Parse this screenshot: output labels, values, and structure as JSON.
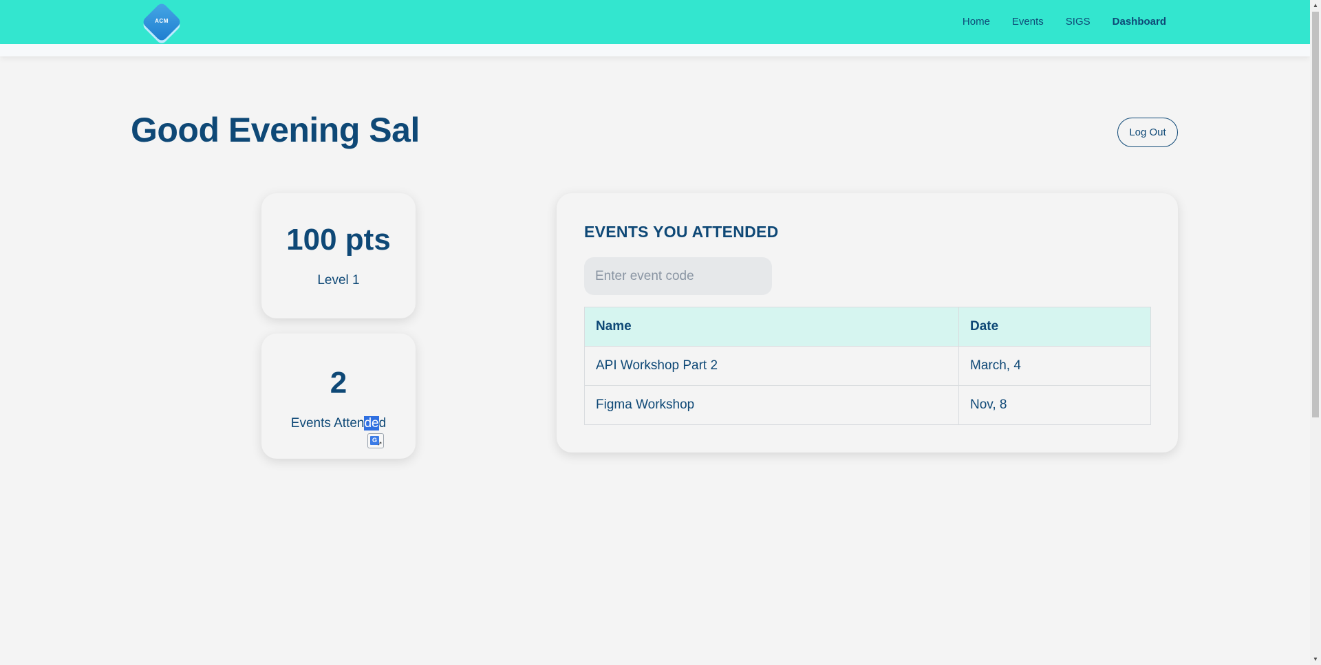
{
  "header": {
    "logo_text": "ACM",
    "nav": [
      {
        "label": "Home"
      },
      {
        "label": "Events"
      },
      {
        "label": "SIGS"
      },
      {
        "label": "Dashboard"
      }
    ]
  },
  "main": {
    "greeting": "Good Evening Sal",
    "logout_label": "Log Out"
  },
  "stats": {
    "points": "100 pts",
    "level": "Level 1",
    "events_count": "2",
    "events_label_part1": "Events Atten",
    "events_label_highlight": "de",
    "events_label_part2": "d"
  },
  "events_panel": {
    "title": "EVENTS YOU ATTENDED",
    "input_placeholder": "Enter event code",
    "columns": [
      "Name",
      "Date"
    ],
    "rows": [
      {
        "name": "API Workshop Part 2",
        "date": "March, 4"
      },
      {
        "name": "Figma Workshop",
        "date": "Nov, 8"
      }
    ]
  },
  "colors": {
    "navbar": "#33e6cf",
    "primary_text": "#0e4876",
    "table_header_bg": "#d6f5f0",
    "background": "#f4f4f4"
  }
}
